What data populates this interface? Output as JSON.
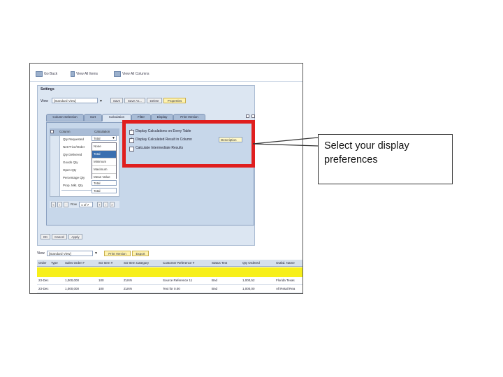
{
  "toolbar": {
    "go_back": "Go Back",
    "view_all_items": "View All Items",
    "view_all_columns": "View All Columns"
  },
  "settings": {
    "title": "Settings",
    "view_label": "View",
    "view_value": "[Standard View]",
    "buttons": [
      "Save",
      "Save As...",
      "Delete",
      "Properties"
    ],
    "tabs": [
      "Column Selection",
      "Sort",
      "Calculation",
      "Filter",
      "Display",
      "Print Version"
    ],
    "active_tab": 2,
    "grid_header": {
      "column": "Column",
      "calculation": "Calculation"
    },
    "columns": [
      "Qty Requested",
      "Net Price/Order",
      "Qty Delivered",
      "Goods Qty",
      "Open Qty",
      "Percentage Qty",
      "Prop. Mkt. Qty"
    ],
    "calc_values": [
      "Total",
      "",
      "",
      "",
      "",
      "Total",
      "Total"
    ],
    "dropdown_options": [
      "None",
      "Total",
      "Minimum",
      "Maximum",
      "Mean Value"
    ],
    "dropdown_selected": 1,
    "pager_label": "Row",
    "pager_value": "1 of 7",
    "options": [
      {
        "label": "Display Calculations on Every Table",
        "checked": true
      },
      {
        "label": "Display Calculated Result in Column",
        "checked": true
      },
      {
        "label": "Calculate Intermediate Results",
        "checked": false
      }
    ],
    "option_value": "Description",
    "footer_buttons": [
      "OK",
      "Cancel",
      "Apply"
    ]
  },
  "results": {
    "view_label": "View",
    "view_value": "[Standard View]",
    "buttons": [
      "Print Version",
      "Export"
    ],
    "headers": [
      "Order",
      "Type",
      "Sales Order #",
      "SO Item #",
      "SO Item Category",
      "Customer Reference #",
      "Status Text",
      "Qty Ordered",
      "Outbd. Name"
    ],
    "rows": [
      [
        "23-Dec",
        "",
        "1,000,000",
        "100",
        "ZLNN",
        "Source Reference 11",
        "Bnd",
        "1,000,52",
        "Florida Texas"
      ],
      [
        "23-Dec",
        "",
        "1,000,000",
        "100",
        "ZLNN",
        "Text for 0.00",
        "Bnd",
        "1,000,00",
        "All Retail Rea"
      ]
    ]
  },
  "callout": {
    "text": "Select your display preferences"
  },
  "colors": {
    "highlight_border": "#e01e1e",
    "panel_bg": "#dce6f2",
    "total_row": "#f7ef1a"
  }
}
